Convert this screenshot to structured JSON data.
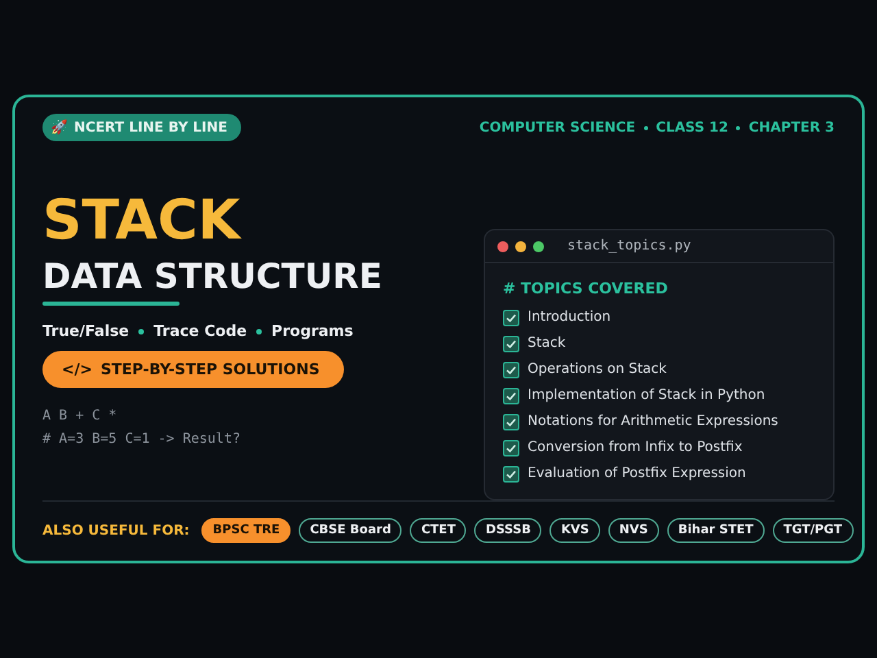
{
  "badge": {
    "icon": "🚀",
    "label": "NCERT LINE BY LINE"
  },
  "breadcrumb": [
    "COMPUTER SCIENCE",
    "CLASS 12",
    "CHAPTER 3"
  ],
  "title": "STACK",
  "subtitle": "DATA STRUCTURE",
  "features": [
    "True/False",
    "Trace Code",
    "Programs"
  ],
  "cta": {
    "icon": "</>",
    "label": "STEP-BY-STEP SOLUTIONS"
  },
  "code_lines": [
    "A B + C *",
    "# A=3 B=5 C=1 -> Result?"
  ],
  "editor": {
    "filename": "stack_topics.py",
    "heading": "# TOPICS COVERED",
    "topics": [
      {
        "label": "Introduction",
        "checked": true
      },
      {
        "label": "Stack",
        "checked": true
      },
      {
        "label": "Operations on Stack",
        "checked": true
      },
      {
        "label": "Implementation of Stack in Python",
        "checked": true
      },
      {
        "label": "Notations for Arithmetic Expressions",
        "checked": true
      },
      {
        "label": "Conversion from Infix to Postfix",
        "checked": true
      },
      {
        "label": "Evaluation of Postfix Expression",
        "checked": true
      }
    ]
  },
  "useful_for": {
    "label": "ALSO USEFUL FOR:",
    "chips": [
      {
        "label": "BPSC TRE",
        "selected": true
      },
      {
        "label": "CBSE Board",
        "selected": false
      },
      {
        "label": "CTET",
        "selected": false
      },
      {
        "label": "DSSSB",
        "selected": false
      },
      {
        "label": "KVS",
        "selected": false
      },
      {
        "label": "NVS",
        "selected": false
      },
      {
        "label": "Bihar STET",
        "selected": false
      },
      {
        "label": "TGT/PGT",
        "selected": false
      }
    ]
  }
}
